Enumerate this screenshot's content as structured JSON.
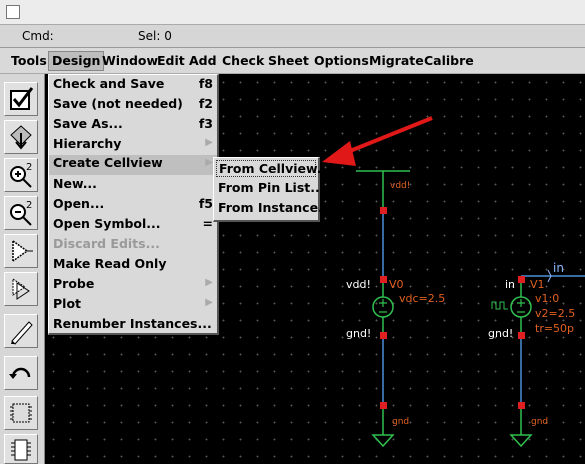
{
  "status": {
    "cmd_label": "Cmd:",
    "sel_label": "Sel: 0"
  },
  "menubar": [
    "Tools",
    "Design",
    "Window",
    "Edit",
    "Add",
    "Check",
    "Sheet",
    "Options",
    "Migrate",
    "Calibre"
  ],
  "active_menu": "Design",
  "design_menu": [
    {
      "label": "Check and Save",
      "shortcut": "f8"
    },
    {
      "label": "Save (not needed)",
      "shortcut": "f2"
    },
    {
      "label": "Save As...",
      "shortcut": "f3"
    },
    {
      "label": "Hierarchy",
      "submenu": true
    },
    {
      "label": "Create Cellview",
      "submenu": true,
      "selected": true
    },
    {
      "label": "New..."
    },
    {
      "label": "Open...",
      "shortcut": "f5"
    },
    {
      "label": "Open Symbol...",
      "shortcut": "="
    },
    {
      "label": "Discard Edits...",
      "disabled": true
    },
    {
      "label": "Make Read Only"
    },
    {
      "label": "Probe",
      "submenu": true
    },
    {
      "label": "Plot",
      "submenu": true
    },
    {
      "label": "Renumber Instances..."
    }
  ],
  "create_cellview_submenu": [
    {
      "label": "From Cellview...",
      "selected": true
    },
    {
      "label": "From Pin List..."
    },
    {
      "label": "From Instance..."
    }
  ],
  "toolbar": [
    {
      "icon": "check-icon"
    },
    {
      "icon": "save-icon"
    },
    {
      "icon": "zoom-in-icon",
      "text": "2"
    },
    {
      "icon": "zoom-out-icon",
      "text": "2"
    },
    {
      "icon": "stretch-icon"
    },
    {
      "icon": "copy-icon"
    },
    {
      "icon": "wire-pencil-icon"
    },
    {
      "icon": "undo-icon"
    },
    {
      "icon": "instance-icon"
    },
    {
      "icon": "chip-icon"
    }
  ],
  "schematic": {
    "net_vdd": "vdd!",
    "vdc_ref": "V0",
    "vdc_net_left": "vdd!",
    "vdc_param": "vdc=2.5",
    "vdc_gnd_left": "gnd!",
    "gnd_label_1": "gnd",
    "pin_in_label": "in",
    "pulse_net_left": "in",
    "pulse_ref": "V1",
    "pulse_params": [
      "v1:0",
      "v2=2.5",
      "tr=50p"
    ],
    "pulse_gnd_left": "gnd!",
    "gnd_label_2": "gnd",
    "pin_label": "in"
  },
  "colors": {
    "wire": "#4a8fd8",
    "pin_red": "#e02020",
    "device_green": "#30c050",
    "label_orange": "#e06020",
    "arrow": "#e01818"
  }
}
